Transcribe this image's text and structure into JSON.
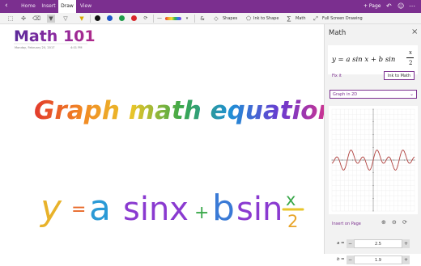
{
  "titlebar": {
    "tabs": [
      "Home",
      "Insert",
      "Draw",
      "View"
    ],
    "active_tab": "Draw",
    "page_label": "+ Page"
  },
  "ribbon": {
    "shapes_label": "Shapes",
    "ink_to_shape_label": "Ink to Shape",
    "math_label": "Math",
    "full_screen_label": "Full Screen Drawing",
    "pen_colors": [
      "#111111",
      "#1e56c8",
      "#1f9a4a",
      "#d9262b"
    ]
  },
  "page": {
    "title": "Math 101",
    "date": "Monday, February 20, 2017",
    "time": "4:01 PM",
    "heading": "Graph math equations!",
    "equation_parts": {
      "y": "y",
      "eq": "=",
      "a": "a",
      "sinx": "sinx",
      "plus": "+",
      "b": "b",
      "sin": "sin",
      "num": "x",
      "den": "2"
    }
  },
  "math_pane": {
    "title": "Math",
    "formula_text": "y = a sin x + b sin",
    "formula_num": "x",
    "formula_den": "2",
    "fix_it_label": "Fix it",
    "ink_to_math_label": "Ink to Math",
    "dropdown_value": "Graph in 2D",
    "insert_label": "Insert on Page",
    "params": [
      {
        "name": "a",
        "value": "2.5"
      },
      {
        "name": "b",
        "value": "1.9"
      }
    ]
  },
  "chart_data": {
    "type": "line",
    "title": "",
    "xlabel": "",
    "ylabel": "",
    "xlim": [
      -20,
      20
    ],
    "ylim": [
      -20,
      20
    ],
    "grid": true,
    "function": "y = 2.5 sin(x) + 1.9 sin(x/2)",
    "series": [
      {
        "x": [
          -20,
          -18,
          -16,
          -14,
          -12,
          -10,
          -8,
          -6,
          -4,
          -2,
          0,
          2,
          4,
          6,
          8,
          10,
          12,
          14,
          16,
          18,
          20
        ],
        "values": [
          -4.8,
          0.8,
          5.2,
          -4.4,
          0.8,
          3.2,
          -4.3,
          -0.5,
          -2.6,
          0.7,
          0,
          -0.7,
          2.6,
          0.5,
          4.3,
          -3.2,
          -0.8,
          4.4,
          -5.2,
          -0.8,
          4.8
        ]
      }
    ]
  }
}
